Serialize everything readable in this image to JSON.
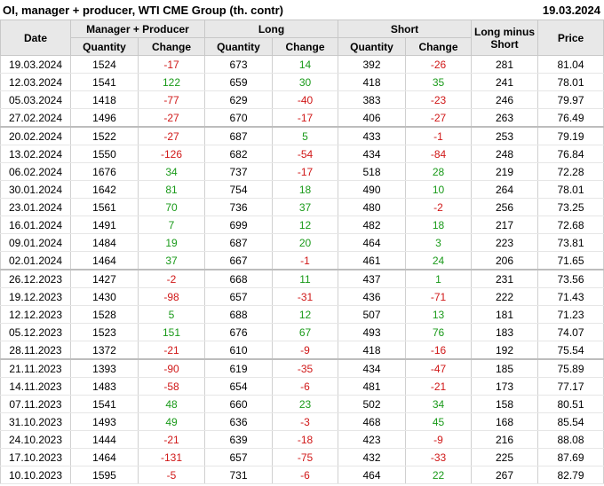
{
  "title": "OI, manager + producer, WTI CME Group (th. contr)",
  "report_date": "19.03.2024",
  "headers": {
    "date": "Date",
    "group_mp": "Manager + Producer",
    "group_long": "Long",
    "group_short": "Short",
    "long_minus_short": "Long minus Short",
    "price": "Price",
    "quantity": "Quantity",
    "change": "Change"
  },
  "colors": {
    "positive": "#1a9a1a",
    "negative": "#d01818",
    "header_bg": "#e8e8e8"
  },
  "rows": [
    [
      "19.03.2024",
      "1524",
      "-17",
      "673",
      "14",
      "392",
      "-26",
      "281",
      "81.04"
    ],
    [
      "12.03.2024",
      "1541",
      "122",
      "659",
      "30",
      "418",
      "35",
      "241",
      "78.01"
    ],
    [
      "05.03.2024",
      "1418",
      "-77",
      "629",
      "-40",
      "383",
      "-23",
      "246",
      "79.97"
    ],
    [
      "27.02.2024",
      "1496",
      "-27",
      "670",
      "-17",
      "406",
      "-27",
      "263",
      "76.49"
    ],
    [
      "20.02.2024",
      "1522",
      "-27",
      "687",
      "5",
      "433",
      "-1",
      "253",
      "79.19"
    ],
    [
      "13.02.2024",
      "1550",
      "-126",
      "682",
      "-54",
      "434",
      "-84",
      "248",
      "76.84"
    ],
    [
      "06.02.2024",
      "1676",
      "34",
      "737",
      "-17",
      "518",
      "28",
      "219",
      "72.28"
    ],
    [
      "30.01.2024",
      "1642",
      "81",
      "754",
      "18",
      "490",
      "10",
      "264",
      "78.01"
    ],
    [
      "23.01.2024",
      "1561",
      "70",
      "736",
      "37",
      "480",
      "-2",
      "256",
      "73.25"
    ],
    [
      "16.01.2024",
      "1491",
      "7",
      "699",
      "12",
      "482",
      "18",
      "217",
      "72.68"
    ],
    [
      "09.01.2024",
      "1484",
      "19",
      "687",
      "20",
      "464",
      "3",
      "223",
      "73.81"
    ],
    [
      "02.01.2024",
      "1464",
      "37",
      "667",
      "-1",
      "461",
      "24",
      "206",
      "71.65"
    ],
    [
      "26.12.2023",
      "1427",
      "-2",
      "668",
      "11",
      "437",
      "1",
      "231",
      "73.56"
    ],
    [
      "19.12.2023",
      "1430",
      "-98",
      "657",
      "-31",
      "436",
      "-71",
      "222",
      "71.43"
    ],
    [
      "12.12.2023",
      "1528",
      "5",
      "688",
      "12",
      "507",
      "13",
      "181",
      "71.23"
    ],
    [
      "05.12.2023",
      "1523",
      "151",
      "676",
      "67",
      "493",
      "76",
      "183",
      "74.07"
    ],
    [
      "28.11.2023",
      "1372",
      "-21",
      "610",
      "-9",
      "418",
      "-16",
      "192",
      "75.54"
    ],
    [
      "21.11.2023",
      "1393",
      "-90",
      "619",
      "-35",
      "434",
      "-47",
      "185",
      "75.89"
    ],
    [
      "14.11.2023",
      "1483",
      "-58",
      "654",
      "-6",
      "481",
      "-21",
      "173",
      "77.17"
    ],
    [
      "07.11.2023",
      "1541",
      "48",
      "660",
      "23",
      "502",
      "34",
      "158",
      "80.51"
    ],
    [
      "31.10.2023",
      "1493",
      "49",
      "636",
      "-3",
      "468",
      "45",
      "168",
      "85.54"
    ],
    [
      "24.10.2023",
      "1444",
      "-21",
      "639",
      "-18",
      "423",
      "-9",
      "216",
      "88.08"
    ],
    [
      "17.10.2023",
      "1464",
      "-131",
      "657",
      "-75",
      "432",
      "-33",
      "225",
      "87.69"
    ],
    [
      "10.10.2023",
      "1595",
      "-5",
      "731",
      "-6",
      "464",
      "22",
      "267",
      "82.79"
    ]
  ]
}
